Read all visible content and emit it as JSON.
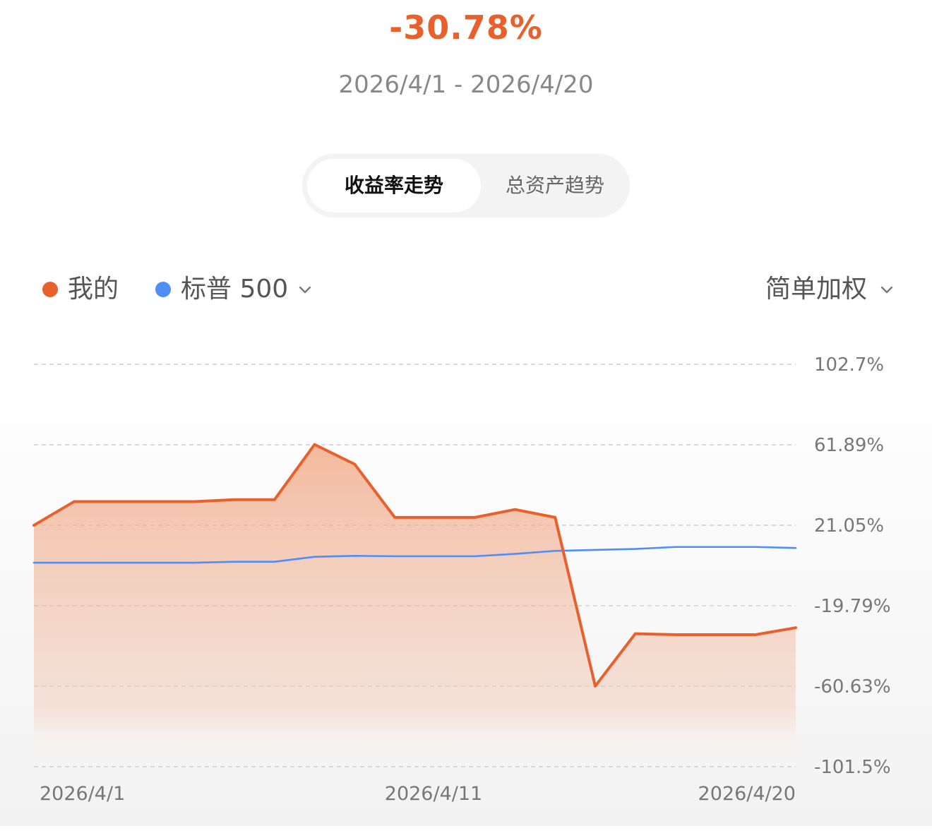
{
  "header": {
    "headline_return": "-30.78%",
    "date_range": "2026/4/1 - 2026/4/20"
  },
  "tabs": [
    {
      "label": "收益率走势",
      "active": true
    },
    {
      "label": "总资产趋势",
      "active": false
    }
  ],
  "legend": {
    "mine": {
      "label": "我的",
      "color": "#e8612c"
    },
    "benchmark": {
      "label": "标普 500",
      "color": "#4f8ef7"
    },
    "weighting": "简单加权"
  },
  "icons": {
    "benchmark_dropdown": "chevron-down-icon",
    "weighting_dropdown": "chevron-down-icon"
  },
  "chart_data": {
    "type": "area",
    "x": [
      "2026/4/1",
      "2026/4/2",
      "2026/4/3",
      "2026/4/4",
      "2026/4/5",
      "2026/4/6",
      "2026/4/7",
      "2026/4/8",
      "2026/4/9",
      "2026/4/10",
      "2026/4/11",
      "2026/4/12",
      "2026/4/13",
      "2026/4/14",
      "2026/4/15",
      "2026/4/16",
      "2026/4/17",
      "2026/4/18",
      "2026/4/19",
      "2026/4/20"
    ],
    "x_tick_labels": [
      "2026/4/1",
      "2026/4/11",
      "2026/4/20"
    ],
    "y_tick_labels": [
      "102.7%",
      "61.89%",
      "21.05%",
      "-19.79%",
      "-60.63%",
      "-101.5%"
    ],
    "ylim": [
      -101.5,
      102.7
    ],
    "grid": true,
    "series": [
      {
        "name": "我的",
        "color": "#e8612c",
        "fill": true,
        "values": [
          21.0,
          33.0,
          33.0,
          33.0,
          33.0,
          34.0,
          34.0,
          62.0,
          52.0,
          25.0,
          25.0,
          25.0,
          29.0,
          25.0,
          -60.6,
          -34.0,
          -34.5,
          -34.5,
          -34.5,
          -31.0
        ]
      },
      {
        "name": "标普 500",
        "color": "#4f8ef7",
        "fill": false,
        "values": [
          2.0,
          2.0,
          2.0,
          2.0,
          2.0,
          2.5,
          2.5,
          5.0,
          5.5,
          5.3,
          5.3,
          5.3,
          6.5,
          8.0,
          8.5,
          9.0,
          10.0,
          10.0,
          10.0,
          9.5
        ]
      }
    ]
  }
}
